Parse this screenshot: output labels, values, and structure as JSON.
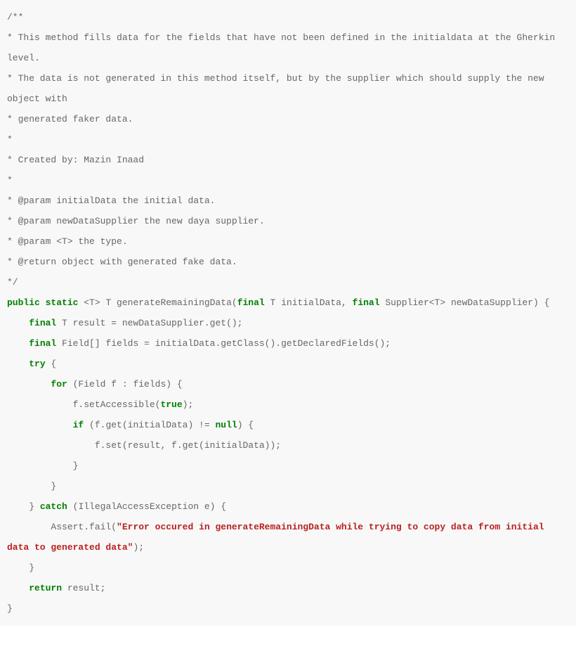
{
  "code": {
    "c1": "/**",
    "c2": "* This method fills data for the fields that have not been defined in the initialdata at the Gherkin level.",
    "c3": "* The data is not generated in this method itself, but by the supplier which should supply the new object with",
    "c4": "* generated faker data.",
    "c5": "*",
    "c6": "* Created by: Mazin Inaad",
    "c7": "*",
    "c8": "* @param initialData the initial data.",
    "c9": "* @param newDataSupplier the new daya supplier.",
    "c10": "* @param <T> the type.",
    "c11": "* @return object with generated fake data.",
    "c12": "*/",
    "kw_public": "public",
    "kw_static": "static",
    "sig_1": " <T> T generateRemainingData(",
    "kw_final_1": "final",
    "sig_2": " T initialData, ",
    "kw_final_2": "final",
    "sig_3": " Supplier<T> newDataSupplier) {",
    "ind1": "    ",
    "kw_final_3": "final",
    "l1": " T result = newDataSupplier.get();",
    "kw_final_4": "final",
    "l2": " Field[] fields = initialData.getClass().getDeclaredFields();",
    "kw_try": "try",
    "l3": " {",
    "ind2": "        ",
    "kw_for": "for",
    "l4": " (Field f : fields) {",
    "ind3": "            ",
    "l5": "f.setAccessible(",
    "kw_true": "true",
    "l6": ");",
    "kw_if": "if",
    "l7": " (f.get(initialData) != ",
    "kw_null": "null",
    "l8": ") {",
    "ind4": "                ",
    "l9": "f.set(result, f.get(initialData));",
    "l10": "}",
    "l11": "}",
    "l12": "} ",
    "kw_catch": "catch",
    "l13": " (IllegalAccessException e) {",
    "l14": "Assert.fail(",
    "str_err": "\"Error occured in generateRemainingData while trying to copy data from initial data to generated data\"",
    "l15": ");",
    "l16": "}",
    "kw_return": "return",
    "l17": " result;",
    "l18": "}"
  }
}
